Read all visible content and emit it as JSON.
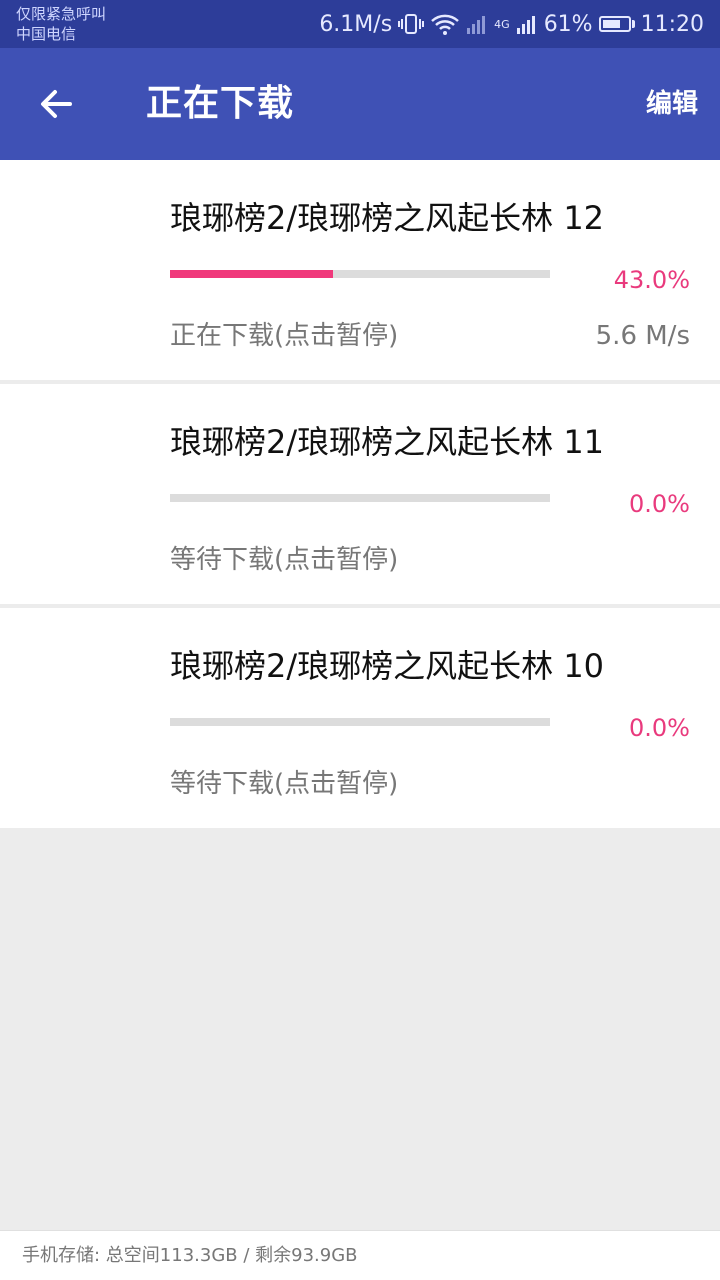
{
  "status_bar": {
    "carrier_line1": "仅限紧急呼叫",
    "carrier_line2": "中国电信",
    "speed": "6.1M/s",
    "network": "4G",
    "battery": "61%",
    "time": "11:20"
  },
  "app_bar": {
    "title": "正在下载",
    "edit_label": "编辑"
  },
  "downloads": [
    {
      "title": "琅琊榜2/琅琊榜之风起长林 12",
      "percent": "43.0%",
      "progress": 0.43,
      "status": "正在下载(点击暂停)",
      "speed": "5.6 M/s"
    },
    {
      "title": "琅琊榜2/琅琊榜之风起长林 11",
      "percent": "0.0%",
      "progress": 0.0,
      "status": "等待下载(点击暂停)",
      "speed": ""
    },
    {
      "title": "琅琊榜2/琅琊榜之风起长林 10",
      "percent": "0.0%",
      "progress": 0.0,
      "status": "等待下载(点击暂停)",
      "speed": ""
    }
  ],
  "footer": {
    "storage_text": "手机存储: 总空间113.3GB / 剩余93.9GB"
  },
  "colors": {
    "status_bar_bg": "#2d3d99",
    "app_bar_bg": "#3f51b5",
    "accent": "#f0397b",
    "track": "#dcdcdc"
  }
}
